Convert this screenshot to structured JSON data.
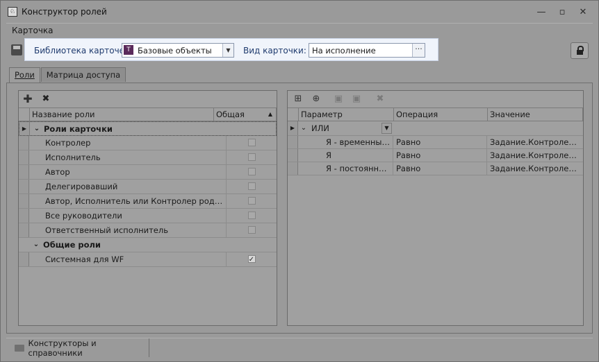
{
  "window": {
    "title": "Конструктор ролей",
    "buttons": [
      "—",
      "▫",
      "✕"
    ]
  },
  "menu": {
    "card": "Карточка"
  },
  "toolbar": {
    "library_label": "Библиотека карточек:",
    "library_value": "Базовые объекты",
    "kind_label": "Вид карточки:",
    "kind_value": "На исполнение",
    "kind_button": "···"
  },
  "tabs": {
    "roles": "Роли",
    "matrix": "Матрица доступа"
  },
  "roles_grid": {
    "columns": {
      "name": "Название роли",
      "common": "Общая"
    },
    "group1": "Роли карточки",
    "group2": "Общие роли",
    "rows": [
      {
        "name": "Контролер",
        "checked": false
      },
      {
        "name": "Исполнитель",
        "checked": false
      },
      {
        "name": "Автор",
        "checked": false
      },
      {
        "name": "Делегировавший",
        "checked": false
      },
      {
        "name": "Автор, Исполнитель или Контролер родите...",
        "checked": false
      },
      {
        "name": "Все руководители",
        "checked": false
      },
      {
        "name": "Ответственный исполнитель",
        "checked": false
      },
      {
        "name": "Системная для WF",
        "checked": true
      }
    ]
  },
  "params_grid": {
    "columns": {
      "param": "Параметр",
      "operation": "Операция",
      "value": "Значение"
    },
    "group": "ИЛИ",
    "rows": [
      {
        "param": "Я - временный з...",
        "operation": "Равно",
        "value": "Задание.Контролер хо..."
      },
      {
        "param": "Я",
        "operation": "Равно",
        "value": "Задание.Контролер хо..."
      },
      {
        "param": "Я - постоянный ...",
        "operation": "Равно",
        "value": "Задание.Контролер хо..."
      }
    ]
  },
  "statusbar": {
    "designers": "Конструкторы и справочники"
  }
}
